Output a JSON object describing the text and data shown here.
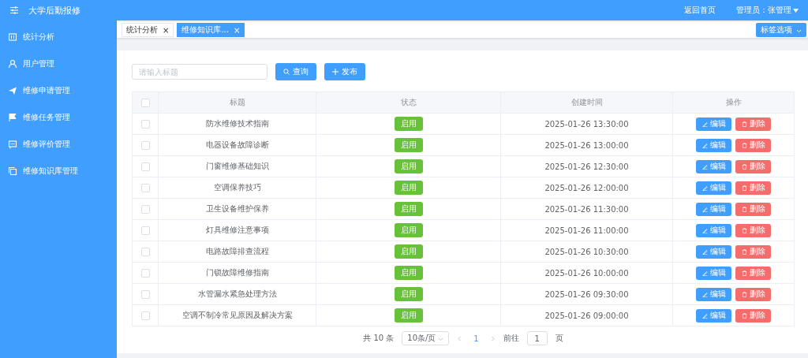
{
  "header": {
    "title": "大学后勤报修",
    "links": [
      "返回首页",
      "管理员：张管理"
    ]
  },
  "sidebar": {
    "items": [
      {
        "label": "统计分析",
        "selected": false
      },
      {
        "label": "用户管理",
        "selected": false
      },
      {
        "label": "维修申请管理",
        "selected": false
      },
      {
        "label": "维修任务管理",
        "selected": false
      },
      {
        "label": "维修评价管理",
        "selected": false
      },
      {
        "label": "维修知识库管理",
        "selected": false
      }
    ]
  },
  "tabs": [
    {
      "label": "统计分析",
      "close": "×",
      "selected": false
    },
    {
      "label": "维修知识库...",
      "close": "×",
      "selected": true
    }
  ],
  "tab_options": "标签选项",
  "search": {
    "placeholder": "请输入标题",
    "buttons": [
      "查询",
      "发布"
    ]
  },
  "table": {
    "select_all_checked": false,
    "columns": [
      "标题",
      "状态",
      "创建时间",
      "操作"
    ],
    "rows": [
      {
        "checked": false,
        "title": "防水维修技术指南",
        "status": "启用",
        "time": "2025-01-26 13:30:00",
        "actions": [
          "编辑",
          "删除"
        ]
      },
      {
        "checked": false,
        "title": "电器设备故障诊断",
        "status": "启用",
        "time": "2025-01-26 13:00:00",
        "actions": [
          "编辑",
          "删除"
        ]
      },
      {
        "checked": false,
        "title": "门窗维修基础知识",
        "status": "启用",
        "time": "2025-01-26 12:30:00",
        "actions": [
          "编辑",
          "删除"
        ]
      },
      {
        "checked": false,
        "title": "空调保养技巧",
        "status": "启用",
        "time": "2025-01-26 12:00:00",
        "actions": [
          "编辑",
          "删除"
        ]
      },
      {
        "checked": false,
        "title": "卫生设备维护保养",
        "status": "启用",
        "time": "2025-01-26 11:30:00",
        "actions": [
          "编辑",
          "删除"
        ]
      },
      {
        "checked": false,
        "title": "灯具维修注意事项",
        "status": "启用",
        "time": "2025-01-26 11:00:00",
        "actions": [
          "编辑",
          "删除"
        ]
      },
      {
        "checked": false,
        "title": "电路故障排查流程",
        "status": "启用",
        "time": "2025-01-26 10:30:00",
        "actions": [
          "编辑",
          "删除"
        ]
      },
      {
        "checked": false,
        "title": "门锁故障维修指南",
        "status": "启用",
        "time": "2025-01-26 10:00:00",
        "actions": [
          "编辑",
          "删除"
        ]
      },
      {
        "checked": false,
        "title": "水管漏水紧急处理方法",
        "status": "启用",
        "time": "2025-01-26 09:30:00",
        "actions": [
          "编辑",
          "删除"
        ]
      },
      {
        "checked": false,
        "title": "空调不制冷常见原因及解决方案",
        "status": "启用",
        "time": "2025-01-26 09:00:00",
        "actions": [
          "编辑",
          "删除"
        ]
      }
    ]
  },
  "pagination": {
    "total": "共 10 条",
    "page_size": "10条/页",
    "pages": [
      {
        "label": "1",
        "selected": true
      }
    ],
    "goto_label": "前往",
    "goto_value": "1",
    "page_suffix": "页"
  }
}
